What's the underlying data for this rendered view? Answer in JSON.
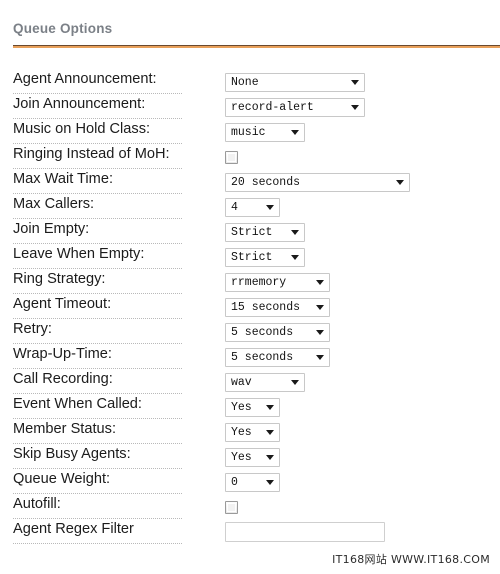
{
  "panel": {
    "title": "Queue Options",
    "accent_color": "#e8a05a",
    "title_color": "#7b8087"
  },
  "rows": [
    {
      "label": "Agent Announcement:",
      "control": "select",
      "value": "None",
      "width": "w-xl"
    },
    {
      "label": "Join Announcement:",
      "control": "select",
      "value": "record-alert",
      "width": "w-xl"
    },
    {
      "label": "Music on Hold Class:",
      "control": "select",
      "value": "music",
      "width": "w-md"
    },
    {
      "label": "Ringing Instead of MoH:",
      "control": "checkbox",
      "value": "",
      "width": ""
    },
    {
      "label": "Max Wait Time:",
      "control": "select",
      "value": "20 seconds",
      "width": "w-xxl"
    },
    {
      "label": "Max Callers:",
      "control": "select",
      "value": "4",
      "width": "w-sm"
    },
    {
      "label": "Join Empty:",
      "control": "select",
      "value": "Strict",
      "width": "w-md"
    },
    {
      "label": "Leave When Empty:",
      "control": "select",
      "value": "Strict",
      "width": "w-md"
    },
    {
      "label": "Ring Strategy:",
      "control": "select",
      "value": "rrmemory",
      "width": "w-lg"
    },
    {
      "label": "Agent Timeout:",
      "control": "select",
      "value": "15 seconds",
      "width": "w-lg"
    },
    {
      "label": "Retry:",
      "control": "select",
      "value": "5 seconds",
      "width": "w-lg"
    },
    {
      "label": "Wrap-Up-Time:",
      "control": "select",
      "value": "5 seconds",
      "width": "w-lg"
    },
    {
      "label": "Call Recording:",
      "control": "select",
      "value": "wav",
      "width": "w-md"
    },
    {
      "label": "Event When Called:",
      "control": "select",
      "value": "Yes",
      "width": "w-sm"
    },
    {
      "label": "Member Status:",
      "control": "select",
      "value": "Yes",
      "width": "w-sm"
    },
    {
      "label": "Skip Busy Agents:",
      "control": "select",
      "value": "Yes",
      "width": "w-sm"
    },
    {
      "label": "Queue Weight:",
      "control": "select",
      "value": "0",
      "width": "w-sm"
    },
    {
      "label": "Autofill:",
      "control": "checkbox",
      "value": "",
      "width": ""
    },
    {
      "label": "Agent Regex Filter",
      "control": "text",
      "value": "",
      "width": ""
    }
  ],
  "watermark": {
    "text": "IT168网站 WWW.IT168.COM"
  }
}
